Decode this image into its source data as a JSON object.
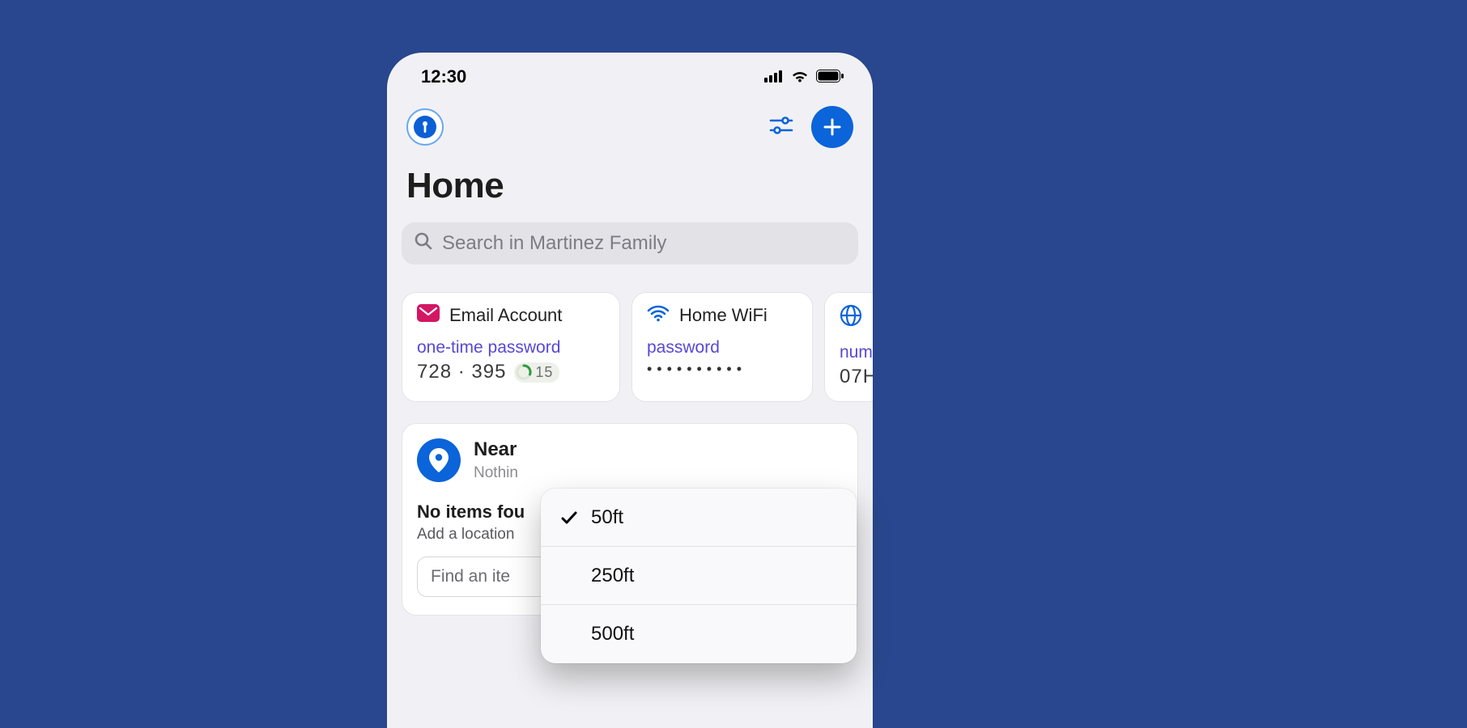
{
  "status_bar": {
    "time": "12:30"
  },
  "header": {
    "page_title": "Home"
  },
  "search": {
    "placeholder": "Search in Martinez Family"
  },
  "cards": [
    {
      "icon": "mail-icon",
      "title": "Email Account",
      "field_label": "one-time password",
      "field_value": "728 · 395",
      "countdown": "15"
    },
    {
      "icon": "wifi-icon",
      "title": "Home WiFi",
      "field_label": "password",
      "field_value": "••••••••••"
    },
    {
      "icon": "globe-icon",
      "title": "",
      "field_label": "num",
      "field_value": "07H"
    }
  ],
  "nearby": {
    "title": "Near",
    "subtitle": "Nothin",
    "no_items_title": "No items fou",
    "no_items_hint": "Add a location",
    "find_placeholder": "Find an ite"
  },
  "distance_menu": {
    "options": [
      {
        "label": "50ft",
        "selected": true
      },
      {
        "label": "250ft",
        "selected": false
      },
      {
        "label": "500ft",
        "selected": false
      }
    ]
  }
}
